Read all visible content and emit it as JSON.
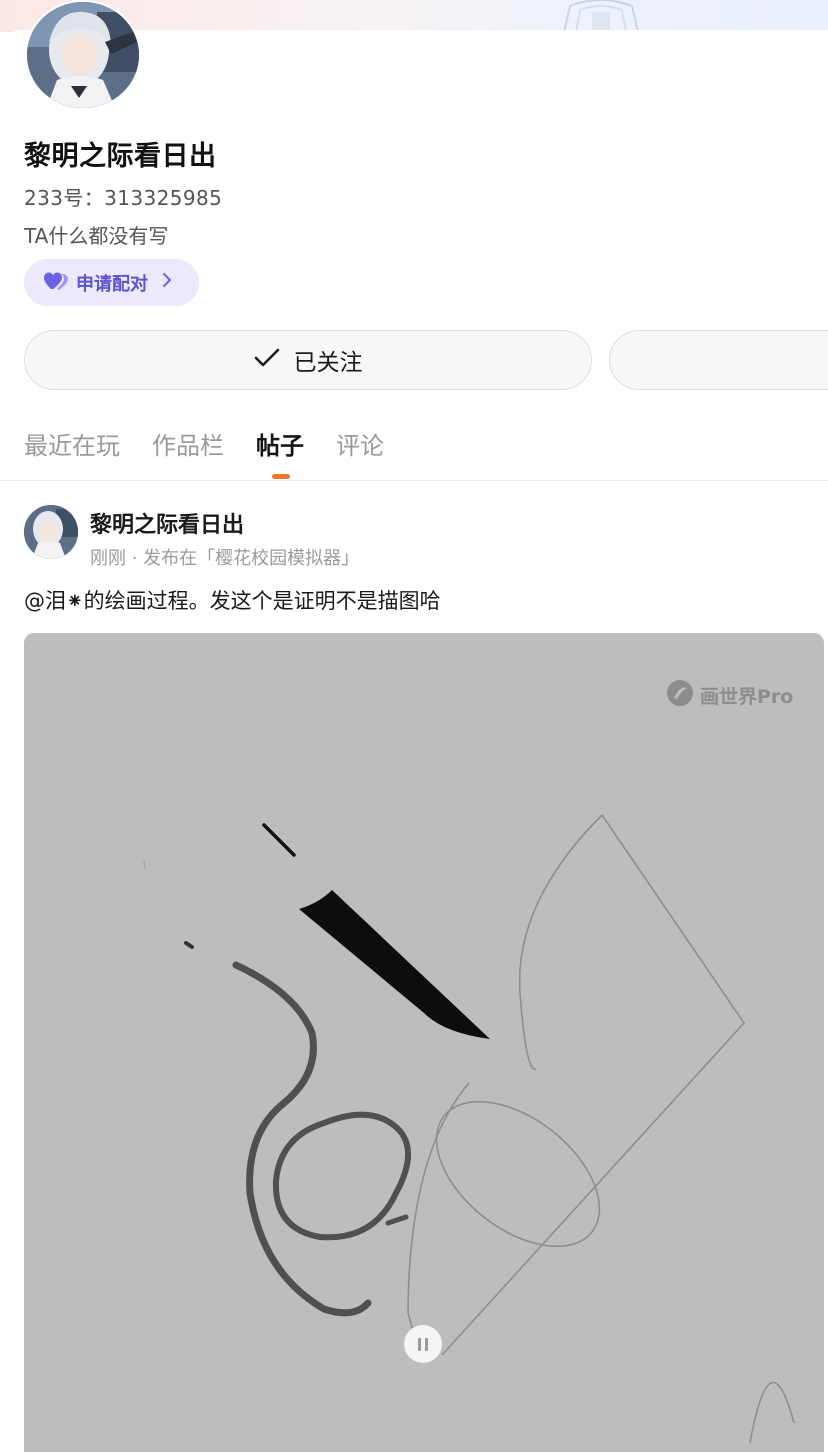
{
  "profile": {
    "username": "黎明之际看日出",
    "uid_line": "233号：313325985",
    "bio": "TA什么都没有写",
    "pair_button_label": "申请配对",
    "follow_button_label": "已关注"
  },
  "tabs": [
    {
      "label": "最近在玩",
      "active": false
    },
    {
      "label": "作品栏",
      "active": false
    },
    {
      "label": "帖子",
      "active": true
    },
    {
      "label": "评论",
      "active": false
    }
  ],
  "post": {
    "author": "黎明之际看日出",
    "meta": "刚刚 · 发布在「樱花校园模拟器」",
    "text": "@泪⁕的绘画过程。发这个是证明不是描图哈",
    "watermark": "画世界Pro"
  },
  "colors": {
    "accent_orange": "#f2762e",
    "pair_purple": "#5b55c9",
    "media_bg": "#bdbdbd"
  },
  "icons": [
    "heart-pair-icon",
    "chevron-right-icon",
    "check-icon",
    "watermark-logo-icon",
    "pause-icon"
  ]
}
